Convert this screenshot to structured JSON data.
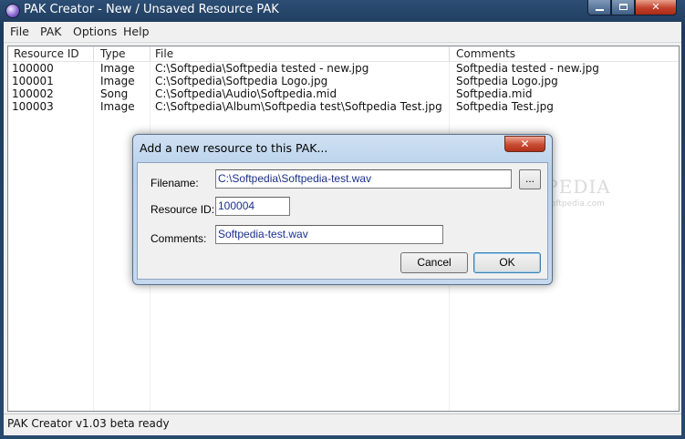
{
  "window": {
    "title": "PAK Creator - New / Unsaved Resource PAK",
    "minimize_glyph": "",
    "close_glyph": "✕"
  },
  "menubar": {
    "items": [
      "File",
      "PAK",
      "Options",
      "Help"
    ]
  },
  "list": {
    "columns": [
      "Resource ID",
      "Type",
      "File",
      "Comments"
    ],
    "rows": [
      {
        "id": "100000",
        "type": "Image",
        "file": "C:\\Softpedia\\Softpedia tested - new.jpg",
        "comment": "Softpedia tested - new.jpg"
      },
      {
        "id": "100001",
        "type": "Image",
        "file": "C:\\Softpedia\\Softpedia Logo.jpg",
        "comment": "Softpedia Logo.jpg"
      },
      {
        "id": "100002",
        "type": "Song",
        "file": "C:\\Softpedia\\Audio\\Softpedia.mid",
        "comment": "Softpedia.mid"
      },
      {
        "id": "100003",
        "type": "Image",
        "file": "C:\\Softpedia\\Album\\Softpedia test\\Softpedia Test.jpg",
        "comment": "Softpedia Test.jpg"
      }
    ]
  },
  "status": {
    "text": "PAK Creator v1.03 beta ready"
  },
  "watermark": {
    "brand": "SOFTPEDIA",
    "url": "www.softpedia.com"
  },
  "dialog": {
    "title": "Add a new resource to this PAK...",
    "close_glyph": "✕",
    "filename_label": "Filename:",
    "filename_value": "C:\\Softpedia\\Softpedia-test.wav",
    "browse_label": "...",
    "resource_id_label": "Resource ID:",
    "resource_id_value": "100004",
    "comments_label": "Comments:",
    "comments_value": "Softpedia-test.wav",
    "cancel_label": "Cancel",
    "ok_label": "OK"
  },
  "colors": {
    "title_bar": "#1e3b5c",
    "close_button": "#c94b33",
    "field_text": "#1a2f8a"
  },
  "icons": {
    "app": "pak-creator-app-icon",
    "minimize": "minimize-icon",
    "maximize": "maximize-icon",
    "close": "close-icon"
  }
}
